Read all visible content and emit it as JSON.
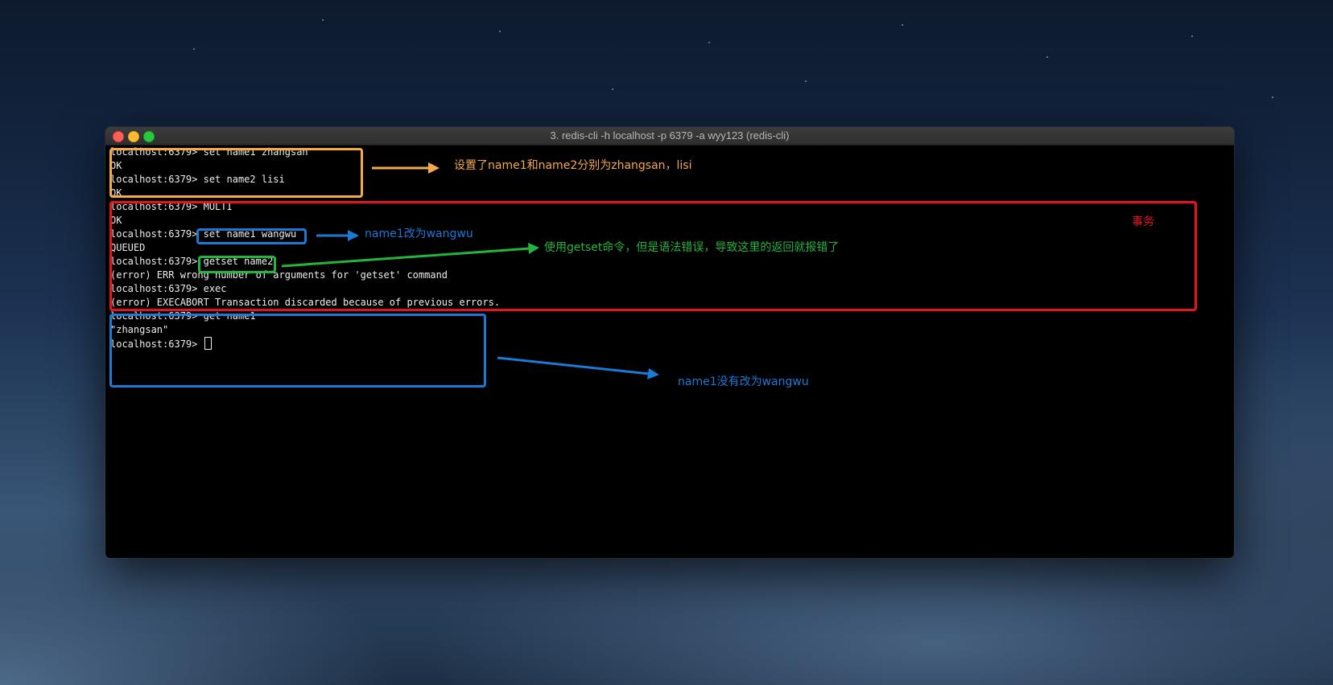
{
  "window": {
    "title": "3. redis-cli -h localhost -p 6379 -a wyy123 (redis-cli)"
  },
  "terminal": {
    "lines": [
      "localhost:6379> set name1 zhangsan",
      "OK",
      "localhost:6379> set name2 lisi",
      "OK",
      "localhost:6379> MULTI",
      "OK",
      "localhost:6379> set name1 wangwu",
      "QUEUED",
      "localhost:6379> getset name2",
      "(error) ERR wrong number of arguments for 'getset' command",
      "localhost:6379> exec",
      "(error) EXECABORT Transaction discarded because of previous errors.",
      "localhost:6379> get name1",
      "\"zhangsan\"",
      "localhost:6379> "
    ]
  },
  "annotations": {
    "set_values": "设置了name1和name2分别为zhangsan，lisi",
    "transaction": "事务",
    "name1_changed": "name1改为wangwu",
    "getset_error": "使用getset命令，但是语法错误，导致这里的返回就报错了",
    "name1_unchanged": "name1没有改为wangwu"
  },
  "colors": {
    "orange": "#f4a94b",
    "red": "#e8131f",
    "blue": "#1a7ad6",
    "green": "#23b53f",
    "close": "#fe5f57",
    "minimize": "#febc2e",
    "zoom": "#28c840"
  }
}
